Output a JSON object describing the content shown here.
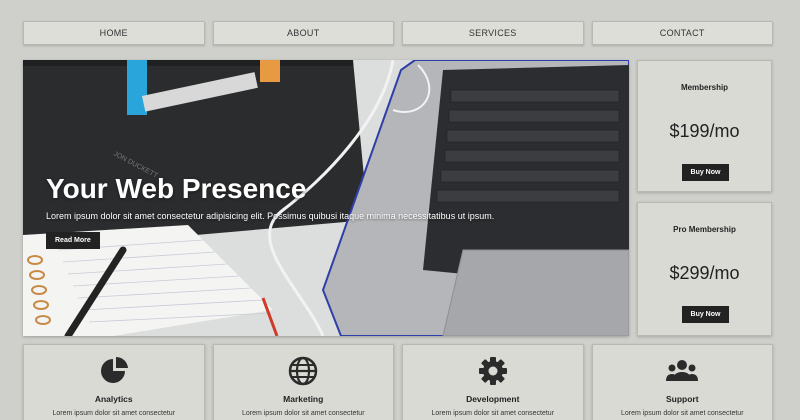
{
  "nav": {
    "items": [
      {
        "label": "HOME"
      },
      {
        "label": "ABOUT"
      },
      {
        "label": "SERVICES"
      },
      {
        "label": "CONTACT"
      }
    ]
  },
  "hero": {
    "title": "Your Web Presence",
    "subtitle": "Lorem ipsum dolor sit amet consectetur adipisicing elit. Possimus quibusi itaque minima necessitatibus ut ipsum.",
    "button_label": "Read More",
    "book_text": "JON DUCKETT"
  },
  "pricing": [
    {
      "name": "Membership",
      "price": "$199/mo",
      "button_label": "Buy Now"
    },
    {
      "name": "Pro Membership",
      "price": "$299/mo",
      "button_label": "Buy Now"
    }
  ],
  "features": [
    {
      "title": "Analytics",
      "icon": "pie-chart-icon",
      "text": "Lorem ipsum dolor sit amet consectetur"
    },
    {
      "title": "Marketing",
      "icon": "globe-icon",
      "text": "Lorem ipsum dolor sit amet consectetur"
    },
    {
      "title": "Development",
      "icon": "cog-icon",
      "text": "Lorem ipsum dolor sit amet consectetur"
    },
    {
      "title": "Support",
      "icon": "users-icon",
      "text": "Lorem ipsum dolor sit amet consectetur"
    }
  ],
  "colors": {
    "background": "#cfcfcb",
    "card": "#dadad5",
    "button": "#222222",
    "icon": "#2b2b2b"
  }
}
